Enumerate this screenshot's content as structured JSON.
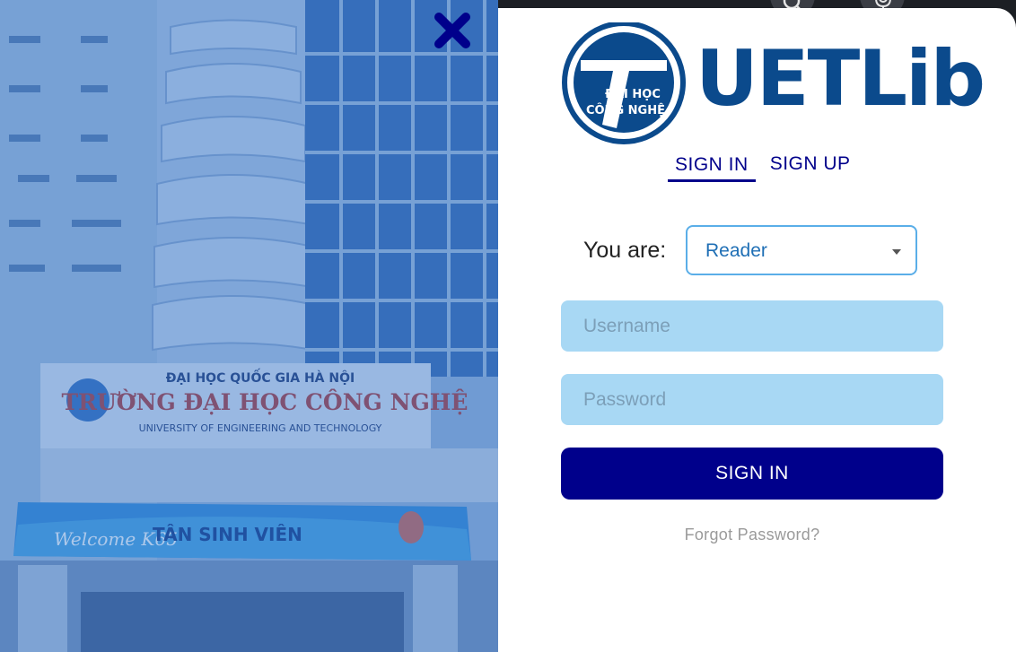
{
  "logo": {
    "name": "UETLib",
    "emblem_line1": "ĐẠI HỌC",
    "emblem_line2": "CÔNG NGHỆ"
  },
  "tabs": [
    {
      "label": "SIGN IN",
      "active": true
    },
    {
      "label": "SIGN UP",
      "active": false
    }
  ],
  "form": {
    "role_label": "You are:",
    "role_value": "Reader",
    "username_placeholder": "Username",
    "password_placeholder": "Password",
    "submit_label": "SIGN IN",
    "forgot_label": "Forgot Password?"
  },
  "photo": {
    "sign_line1": "ĐẠI HỌC QUỐC GIA HÀ NỘI",
    "sign_line2": "TRƯỜNG ĐẠI HỌC CÔNG NGHỆ",
    "sign_line3": "UNIVERSITY OF ENGINEERING AND TECHNOLOGY",
    "banner_welcome": "Welcome K65",
    "banner_title": "TÂN SINH VIÊN"
  },
  "icons": {
    "close": "close-icon",
    "search": "search-icon",
    "microphone": "microphone-icon"
  },
  "colors": {
    "brand_navy": "#00008b",
    "logo_blue": "#0b4a8c",
    "field_bg": "#a8d8f4",
    "select_border": "#5aaee8"
  }
}
